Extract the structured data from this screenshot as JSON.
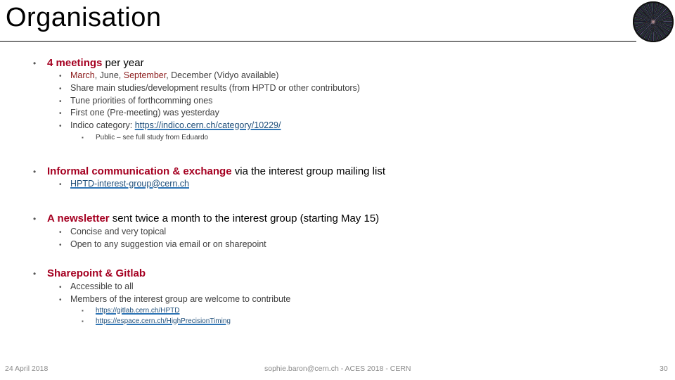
{
  "slide": {
    "title": "Organisation",
    "logo": "cern-event-display-logo"
  },
  "sections": {
    "meetings": {
      "highlight": "4 meetings",
      "rest": " per year",
      "items": {
        "dates": {
          "march": "March",
          "sep1": ", June, ",
          "september": "September",
          "rest": ", December (Vidyo available)"
        },
        "share": "Share main studies/development results (from HPTD or other contributors)",
        "tune": "Tune priorities of forthcomming ones",
        "first": "First one (Pre-meeting) was yesterday",
        "indico_label": "Indico category: ",
        "indico_link": "https://indico.cern.ch/category/10229/",
        "public": "Public – see full study from Eduardo"
      }
    },
    "informal": {
      "highlight": "Informal communication & exchange",
      "rest": " via the interest group mailing list",
      "email": "HPTD-interest-group@cern.ch"
    },
    "newsletter": {
      "highlight": "A newsletter",
      "rest": " sent twice a month to the interest group (starting May 15)",
      "items": [
        "Concise and very topical",
        "Open to any suggestion via email or on sharepoint"
      ]
    },
    "sharepoint": {
      "highlight": "Sharepoint & Gitlab",
      "items": [
        "Accessible to all",
        "Members of the interest group are welcome to contribute"
      ],
      "links": [
        "https://gitlab.cern.ch/HPTD",
        "https://espace.cern.ch/HighPrecisionTiming"
      ]
    }
  },
  "footer": {
    "date": "24 April 2018",
    "center": "sophie.baron@cern.ch - ACES 2018 - CERN",
    "page_number": "30"
  },
  "bullet_char": "•",
  "colors": {
    "highlight": "#A50021",
    "link": "#1F4E79",
    "text": "#404040"
  }
}
